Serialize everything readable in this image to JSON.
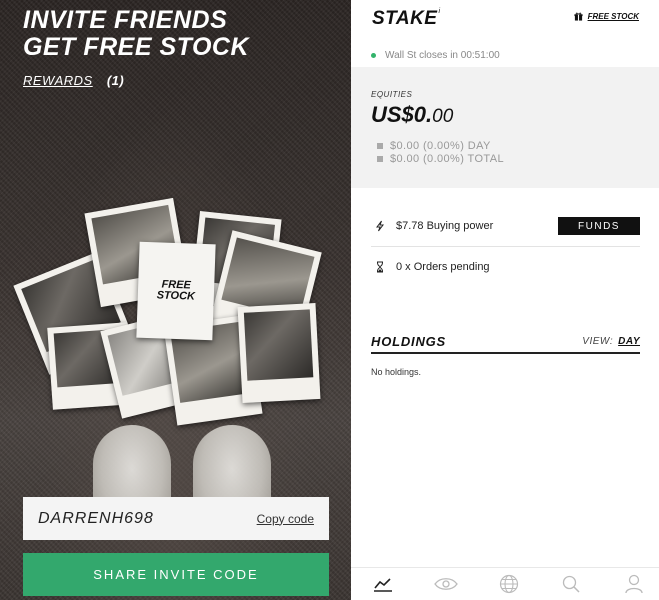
{
  "invite": {
    "title_line1": "INVITE FRIENDS",
    "title_line2": "GET FREE STOCK",
    "rewards_label": "REWARDS",
    "rewards_count": "(1)",
    "free_card_text": "FREE\nSTOCK",
    "invite_code": "DARRENH698",
    "copy_code_label": "Copy code",
    "share_button_label": "SHARE INVITE CODE"
  },
  "header": {
    "logo": "STAKE",
    "logo_mark": "i",
    "free_stock_label": "FREE STOCK",
    "free_stock_icon": "gift-icon"
  },
  "market_status": {
    "text": "Wall St closes in 00:51:00",
    "indicator_color": "#33b36b"
  },
  "equities": {
    "label": "EQUITIES",
    "value_main": "US$0.",
    "value_cents": "00",
    "day_change": "$0.00 (0.00%) DAY",
    "total_change": "$0.00 (0.00%) TOTAL"
  },
  "buying_power": {
    "icon": "bolt-icon",
    "text": "$7.78 Buying power",
    "button_label": "FUNDS"
  },
  "orders": {
    "icon": "hourglass-icon",
    "text": "0 x Orders pending"
  },
  "holdings": {
    "title": "HOLDINGS",
    "view_label": "VIEW:",
    "view_value": "DAY",
    "empty_text": "No holdings."
  },
  "bottom_nav": [
    {
      "icon": "chart-icon"
    },
    {
      "icon": "eye-icon"
    },
    {
      "icon": "globe-icon"
    },
    {
      "icon": "search-icon"
    },
    {
      "icon": "profile-icon"
    }
  ],
  "colors": {
    "accent_green": "#33a86d",
    "funds_button": "#111111"
  }
}
